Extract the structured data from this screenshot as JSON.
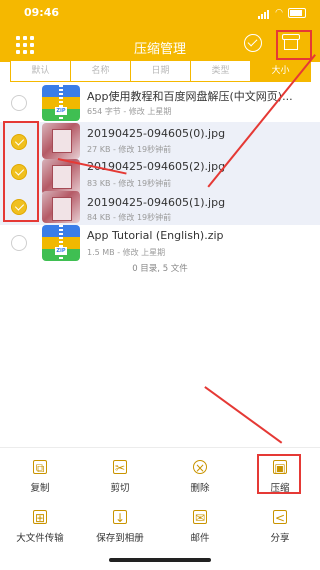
{
  "status": {
    "time": "09:46"
  },
  "header": {
    "title": "压缩管理"
  },
  "sort_tabs": [
    {
      "label": "默认",
      "active": false
    },
    {
      "label": "名称",
      "active": false
    },
    {
      "label": "日期",
      "active": false
    },
    {
      "label": "类型",
      "active": false
    },
    {
      "label": "大小",
      "active": true
    }
  ],
  "files": [
    {
      "name": "App使用教程和百度网盘解压(中文网页)...",
      "meta": "654 字节 - 修改 上星期",
      "kind": "zip",
      "selected": false,
      "icon": "zip-archive-icon"
    },
    {
      "name": "20190425-094605(0).jpg",
      "meta": "27 KB - 修改 19秒钟前",
      "kind": "jpg",
      "selected": true,
      "icon": "image-thumbnail"
    },
    {
      "name": "20190425-094605(2).jpg",
      "meta": "83 KB - 修改 19秒钟前",
      "kind": "jpg",
      "selected": true,
      "icon": "image-thumbnail"
    },
    {
      "name": "20190425-094605(1).jpg",
      "meta": "84 KB - 修改 19秒钟前",
      "kind": "jpg",
      "selected": true,
      "icon": "image-thumbnail"
    },
    {
      "name": "App Tutorial (English).zip",
      "meta": "1.5 MB - 修改 上星期",
      "kind": "zip",
      "selected": false,
      "icon": "zip-archive-icon"
    }
  ],
  "list_footer": "0 目录, 5 文件",
  "toolbar": {
    "row1": [
      {
        "label": "复制",
        "icon": "copy-icon"
      },
      {
        "label": "剪切",
        "icon": "cut-icon"
      },
      {
        "label": "删除",
        "icon": "delete-icon"
      },
      {
        "label": "压缩",
        "icon": "compress-icon"
      }
    ],
    "row2": [
      {
        "label": "大文件传输",
        "icon": "transfer-icon"
      },
      {
        "label": "保存到相册",
        "icon": "save-album-icon"
      },
      {
        "label": "邮件",
        "icon": "mail-icon"
      },
      {
        "label": "分享",
        "icon": "share-icon"
      }
    ]
  },
  "colors": {
    "accent": "#f5b800",
    "annotation": "#e53935",
    "selected_row": "#edf0f8"
  }
}
